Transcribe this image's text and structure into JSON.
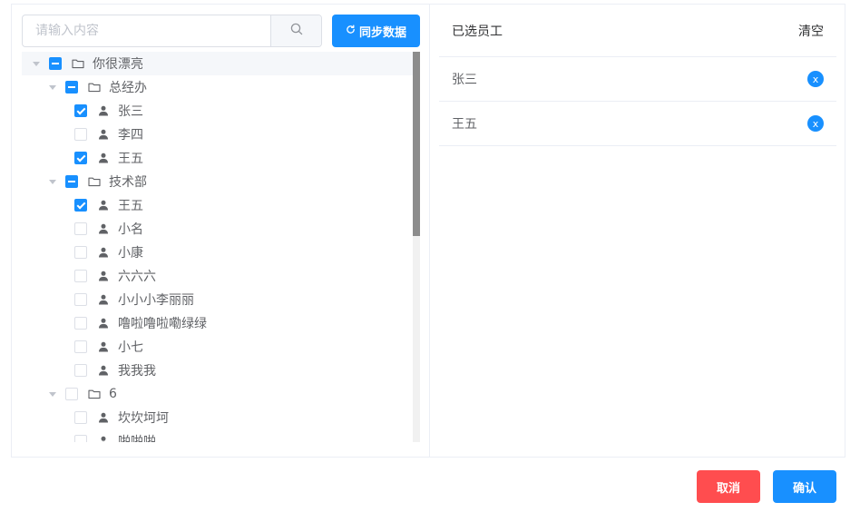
{
  "search": {
    "placeholder": "请输入内容",
    "value": ""
  },
  "sync_button": {
    "label": "同步数据"
  },
  "tree": [
    {
      "label": "你很漂亮",
      "level": 0,
      "type": "folder",
      "state": "indeterminate",
      "expanded": true
    },
    {
      "label": "总经办",
      "level": 1,
      "type": "folder",
      "state": "indeterminate",
      "expanded": true
    },
    {
      "label": "张三",
      "level": 2,
      "type": "user",
      "state": "checked"
    },
    {
      "label": "李四",
      "level": 2,
      "type": "user",
      "state": "unchecked"
    },
    {
      "label": "王五",
      "level": 2,
      "type": "user",
      "state": "checked"
    },
    {
      "label": "技术部",
      "level": 1,
      "type": "folder",
      "state": "indeterminate",
      "expanded": true
    },
    {
      "label": "王五",
      "level": 2,
      "type": "user",
      "state": "checked"
    },
    {
      "label": "小名",
      "level": 2,
      "type": "user",
      "state": "unchecked"
    },
    {
      "label": "小康",
      "level": 2,
      "type": "user",
      "state": "unchecked"
    },
    {
      "label": "六六六",
      "level": 2,
      "type": "user",
      "state": "unchecked"
    },
    {
      "label": "小小小李丽丽",
      "level": 2,
      "type": "user",
      "state": "unchecked"
    },
    {
      "label": "噜啦噜啦嘞绿绿",
      "level": 2,
      "type": "user",
      "state": "unchecked"
    },
    {
      "label": "小七",
      "level": 2,
      "type": "user",
      "state": "unchecked"
    },
    {
      "label": "我我我",
      "level": 2,
      "type": "user",
      "state": "unchecked"
    },
    {
      "label": "6",
      "level": 1,
      "type": "folder",
      "state": "unchecked",
      "expanded": true
    },
    {
      "label": "坎坎坷坷",
      "level": 2,
      "type": "user",
      "state": "unchecked"
    },
    {
      "label": "啪啪啪",
      "level": 2,
      "type": "user",
      "state": "unchecked"
    }
  ],
  "selected": {
    "title": "已选员工",
    "clear_label": "清空",
    "items": [
      {
        "name": "张三",
        "remove": "x"
      },
      {
        "name": "王五",
        "remove": "x"
      }
    ]
  },
  "footer": {
    "cancel_label": "取消",
    "confirm_label": "确认"
  },
  "colors": {
    "primary": "#1890ff",
    "danger": "#ff4d4f",
    "border": "#ebeef5"
  }
}
